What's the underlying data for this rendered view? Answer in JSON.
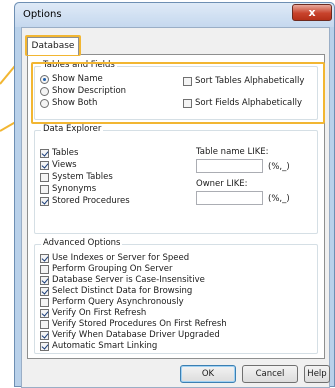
{
  "window": {
    "title": "Options",
    "close_glyph": "x"
  },
  "tabs": [
    {
      "label": "Database"
    }
  ],
  "tables_and_fields": {
    "label": "Tables and Fields",
    "radios": [
      {
        "label": "Show Name",
        "checked": true
      },
      {
        "label": "Show Description",
        "checked": false
      },
      {
        "label": "Show Both",
        "checked": false
      }
    ],
    "checkboxes": [
      {
        "label": "Sort Tables Alphabetically",
        "checked": false
      },
      {
        "label": "Sort Fields Alphabetically",
        "checked": false
      }
    ]
  },
  "data_explorer": {
    "label": "Data Explorer",
    "items": [
      {
        "label": "Tables",
        "checked": true
      },
      {
        "label": "Views",
        "checked": true
      },
      {
        "label": "System Tables",
        "checked": false
      },
      {
        "label": "Synonyms",
        "checked": false
      },
      {
        "label": "Stored Procedures",
        "checked": true
      }
    ],
    "table_name_like": {
      "label": "Table name LIKE:",
      "value": "",
      "suffix": "(%,_)"
    },
    "owner_like": {
      "label": "Owner LIKE:",
      "value": "",
      "suffix": "(%,_)"
    }
  },
  "advanced_options": {
    "label": "Advanced Options",
    "items": [
      {
        "label": "Use Indexes or Server for Speed",
        "checked": true
      },
      {
        "label": "Perform Grouping On Server",
        "checked": false
      },
      {
        "label": "Database Server is Case-Insensitive",
        "checked": true
      },
      {
        "label": "Select Distinct Data for Browsing",
        "checked": true
      },
      {
        "label": "Perform Query Asynchronously",
        "checked": false
      },
      {
        "label": "Verify On First Refresh",
        "checked": true
      },
      {
        "label": "Verify Stored Procedures On First Refresh",
        "checked": false
      },
      {
        "label": "Verify When Database Driver Upgraded",
        "checked": true
      },
      {
        "label": "Automatic Smart Linking",
        "checked": true
      }
    ]
  },
  "buttons": {
    "ok": "OK",
    "cancel": "Cancel",
    "help": "Help"
  },
  "colors": {
    "highlight": "#f2b632",
    "titlebar": "#c5d8ee",
    "close": "#c8432c"
  }
}
